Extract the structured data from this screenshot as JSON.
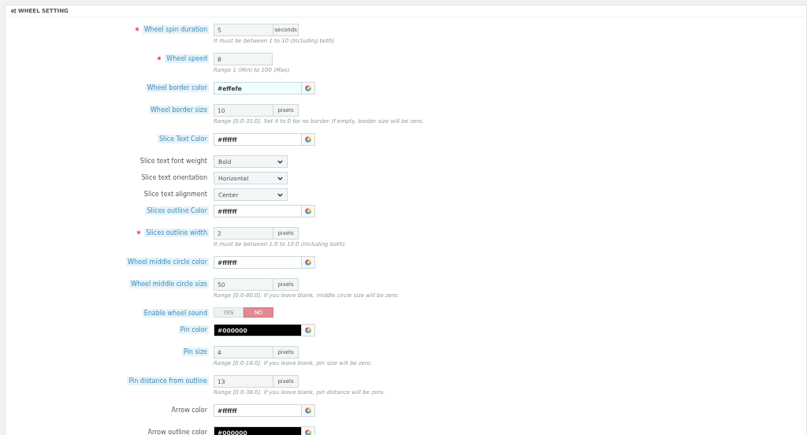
{
  "panel": {
    "title": "WHEEL SETTING"
  },
  "fields": [
    {
      "kind": "text",
      "label": "Wheel spin duration",
      "required": true,
      "help": true,
      "value": "5",
      "unit": "seconds",
      "hint": "It must be between 1 to 10 (Including both)"
    },
    {
      "kind": "text",
      "label": "Wheel speed",
      "required": true,
      "help": true,
      "value": "8",
      "hint": "Range 1 (Min) to 100 (Max)."
    },
    {
      "kind": "color",
      "label": "Wheel border color",
      "required": false,
      "help": true,
      "value": "#effefe"
    },
    {
      "kind": "text",
      "label": "Wheel border size",
      "required": false,
      "help": true,
      "value": "10",
      "unit": "pixels",
      "hint": "Range [0.0-35.0]. Set it to 0 for no border. If empty, border size will be zero."
    },
    {
      "kind": "color",
      "label": "Slice Text Color",
      "required": false,
      "help": true,
      "value": "#ffffff"
    },
    {
      "kind": "select",
      "label": "Slice text font weight",
      "required": false,
      "help": false,
      "value": "Bold"
    },
    {
      "kind": "select",
      "label": "Slice text orientation",
      "required": false,
      "help": false,
      "value": "Horizontal"
    },
    {
      "kind": "select",
      "label": "Slice text alignment",
      "required": false,
      "help": false,
      "value": "Center"
    },
    {
      "kind": "color",
      "label": "Slices outline Color",
      "required": false,
      "help": true,
      "value": "#ffffff"
    },
    {
      "kind": "text",
      "label": "Slices outline width",
      "required": true,
      "help": true,
      "value": "2",
      "unit": "pixels",
      "hint": "It must be between 1.0 to 10.0 (Including both)."
    },
    {
      "kind": "color",
      "label": "Wheel middle circle color",
      "required": false,
      "help": true,
      "value": "#ffffff"
    },
    {
      "kind": "text",
      "label": "Wheel middle circle size",
      "required": false,
      "help": true,
      "value": "50",
      "unit": "pixels",
      "hint": "Range [0.0-80.0]. If you leave blank, middle circle size will be zero."
    },
    {
      "kind": "switch",
      "label": "Enable wheel sound",
      "required": false,
      "help": true,
      "options": [
        {
          "label": "YES",
          "selected": false
        },
        {
          "label": "NO",
          "selected": true
        }
      ]
    },
    {
      "kind": "color",
      "label": "Pin color",
      "required": false,
      "help": true,
      "value": "#000000"
    },
    {
      "kind": "text",
      "label": "Pin size",
      "required": false,
      "help": true,
      "value": "4",
      "unit": "pixels",
      "hint": "Range [0.0-18.0]. If you leave blank, pin size will be zero."
    },
    {
      "kind": "text",
      "label": "Pin distance from outline",
      "required": false,
      "help": true,
      "value": "13",
      "unit": "pixels",
      "hint": "Range [0.0-38.0]. If you leave blank, pin distance will be zero."
    },
    {
      "kind": "color",
      "label": "Arrow color",
      "required": false,
      "help": false,
      "value": "#ffffff"
    },
    {
      "kind": "color",
      "label": "Arrow outline color",
      "required": false,
      "help": false,
      "value": "#000000"
    }
  ]
}
